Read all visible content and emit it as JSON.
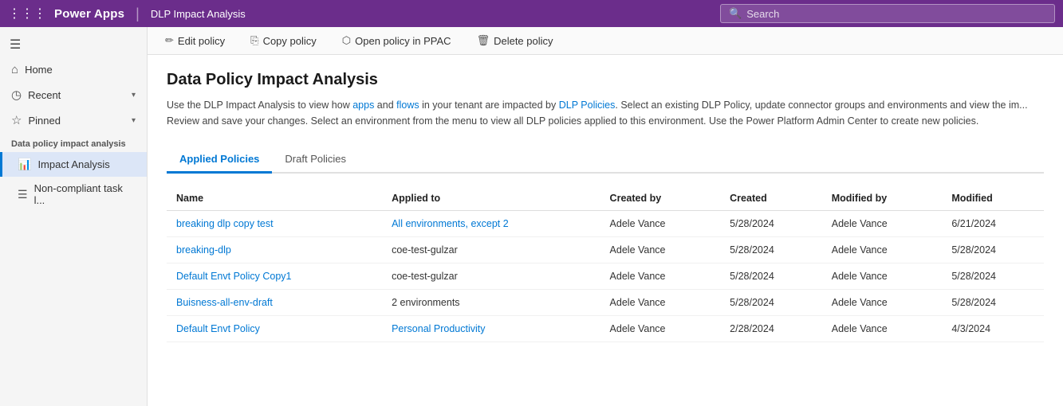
{
  "topnav": {
    "brand": "Power Apps",
    "divider": "|",
    "title": "DLP Impact Analysis",
    "search_placeholder": "Search"
  },
  "sidebar": {
    "hamburger_label": "☰",
    "home_label": "Home",
    "recent_label": "Recent",
    "pinned_label": "Pinned",
    "section_label": "Data policy impact analysis",
    "impact_analysis_label": "Impact Analysis",
    "non_compliant_label": "Non-compliant task l..."
  },
  "toolbar": {
    "edit_policy": "Edit policy",
    "copy_policy": "Copy policy",
    "open_policy_ppac": "Open policy in PPAC",
    "delete_policy": "Delete policy"
  },
  "page": {
    "title": "Data Policy Impact Analysis",
    "description": "Use the DLP Impact Analysis to view how apps and flows in your tenant are impacted by DLP Policies. Select an existing DLP Policy, update connector groups and environments and view the im... Review and save your changes. Select an environment from the menu to view all DLP policies applied to this environment. Use the Power Platform Admin Center to create new policies."
  },
  "tabs": [
    {
      "label": "Applied Policies",
      "active": true
    },
    {
      "label": "Draft Policies",
      "active": false
    }
  ],
  "table": {
    "columns": [
      "Name",
      "Applied to",
      "Created by",
      "Created",
      "Modified by",
      "Modified"
    ],
    "rows": [
      {
        "name": "breaking dlp copy test",
        "applied_to": "All environments, except 2",
        "created_by": "Adele Vance",
        "created": "5/28/2024",
        "modified_by": "Adele Vance",
        "modified": "6/21/2024",
        "name_link": true,
        "applied_link": true
      },
      {
        "name": "breaking-dlp",
        "applied_to": "coe-test-gulzar",
        "created_by": "Adele Vance",
        "created": "5/28/2024",
        "modified_by": "Adele Vance",
        "modified": "5/28/2024",
        "name_link": true,
        "applied_link": false
      },
      {
        "name": "Default Envt Policy Copy1",
        "applied_to": "coe-test-gulzar",
        "created_by": "Adele Vance",
        "created": "5/28/2024",
        "modified_by": "Adele Vance",
        "modified": "5/28/2024",
        "name_link": true,
        "applied_link": false
      },
      {
        "name": "Buisness-all-env-draft",
        "applied_to": "2 environments",
        "created_by": "Adele Vance",
        "created": "5/28/2024",
        "modified_by": "Adele Vance",
        "modified": "5/28/2024",
        "name_link": true,
        "applied_link": false
      },
      {
        "name": "Default Envt Policy",
        "applied_to": "Personal Productivity",
        "created_by": "Adele Vance",
        "created": "2/28/2024",
        "modified_by": "Adele Vance",
        "modified": "4/3/2024",
        "name_link": true,
        "applied_link": true
      }
    ]
  }
}
